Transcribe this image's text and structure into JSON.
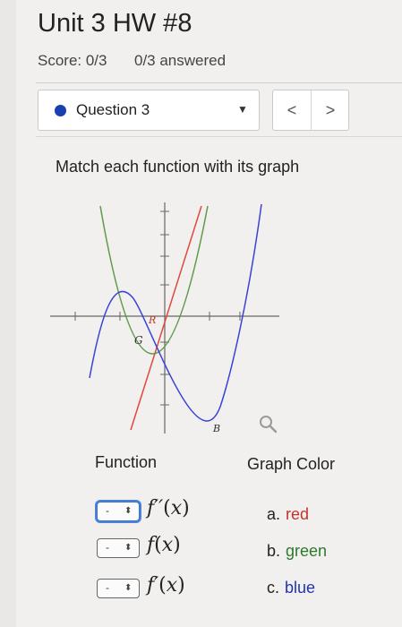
{
  "header": {
    "title": "Unit 3 HW #8",
    "score": "Score: 0/3",
    "answered": "0/3 answered"
  },
  "question_nav": {
    "label": "Question 3",
    "caret_icon": "caret-down-icon",
    "prev_label": "<",
    "next_label": ">"
  },
  "question": {
    "prompt": "Match each function with its graph",
    "graph": {
      "curve_labels": [
        "R",
        "G",
        "B"
      ],
      "curve_colors": {
        "R": "#e0483f",
        "G": "#5f9a4a",
        "B": "#3a43d6"
      }
    },
    "headers": {
      "function": "Function",
      "color": "Graph Color"
    },
    "rows": [
      {
        "select_value": "-",
        "select_arrows": "⬍",
        "func_name": "f′′",
        "func_arg": "x"
      },
      {
        "select_value": "-",
        "select_arrows": "⬍",
        "func_name": "f",
        "func_arg": "x"
      },
      {
        "select_value": "-",
        "select_arrows": "⬍",
        "func_name": "f′",
        "func_arg": "x"
      }
    ],
    "options": [
      {
        "letter": "a.",
        "text": "red",
        "color": "#c0352b"
      },
      {
        "letter": "b.",
        "text": "green",
        "color": "#2d7a2d"
      },
      {
        "letter": "c.",
        "text": "blue",
        "color": "#1f35b5"
      }
    ]
  }
}
